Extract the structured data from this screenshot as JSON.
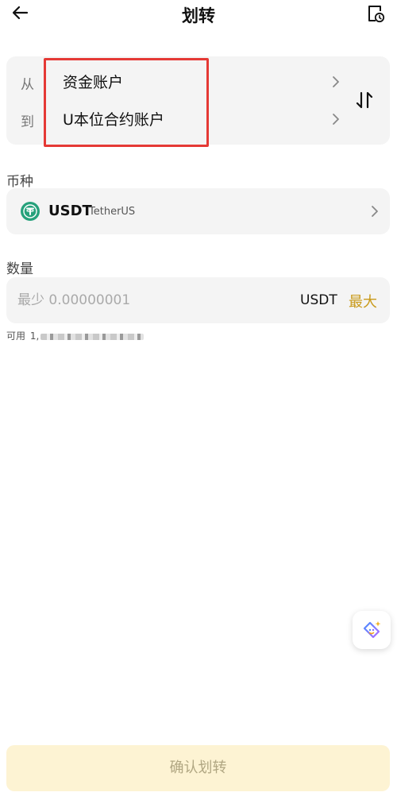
{
  "header": {
    "title": "划转",
    "back_icon": "arrow-left-icon",
    "history_icon": "clock-document-icon"
  },
  "transfer": {
    "from_label": "从",
    "from_account": "资金账户",
    "to_label": "到",
    "to_account": "U本位合约账户",
    "swap_icon": "swap-vertical-icon",
    "highlight_color": "#e53935"
  },
  "coin": {
    "section_label": "币种",
    "symbol": "USDT",
    "name": "TetherUS",
    "icon": "tether-icon",
    "icon_color": "#26a17b"
  },
  "amount": {
    "section_label": "数量",
    "placeholder": "最少 0.00000001",
    "unit": "USDT",
    "max_label": "最大",
    "max_color": "#c99a1a"
  },
  "available": {
    "label": "可用",
    "value_prefix": "1,"
  },
  "assistant": {
    "icon": "ai-assistant-icon"
  },
  "confirm": {
    "label": "确认划转",
    "bg_color": "#fdf3d3"
  }
}
